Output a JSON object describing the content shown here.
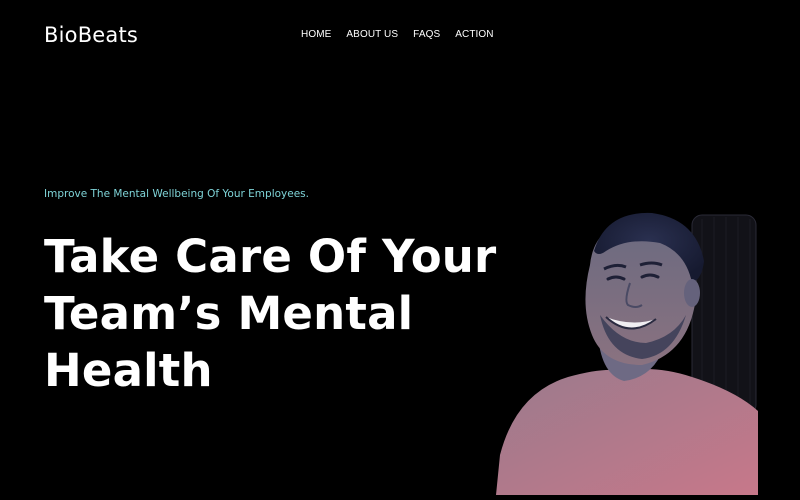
{
  "header": {
    "logo": "BioBeats",
    "nav": [
      "HOME",
      "ABOUT US",
      "FAQS",
      "ACTION"
    ]
  },
  "hero": {
    "eyebrow": "Improve The Mental Wellbeing Of Your Employees.",
    "title_lines": [
      "Take Care Of Your",
      "Team’s Mental",
      "Health"
    ]
  },
  "colors": {
    "background": "#000000",
    "text": "#ffffff",
    "accent": "#7fd4d8",
    "portrait_top": "#5a5f9a",
    "portrait_bottom": "#c7788a"
  }
}
